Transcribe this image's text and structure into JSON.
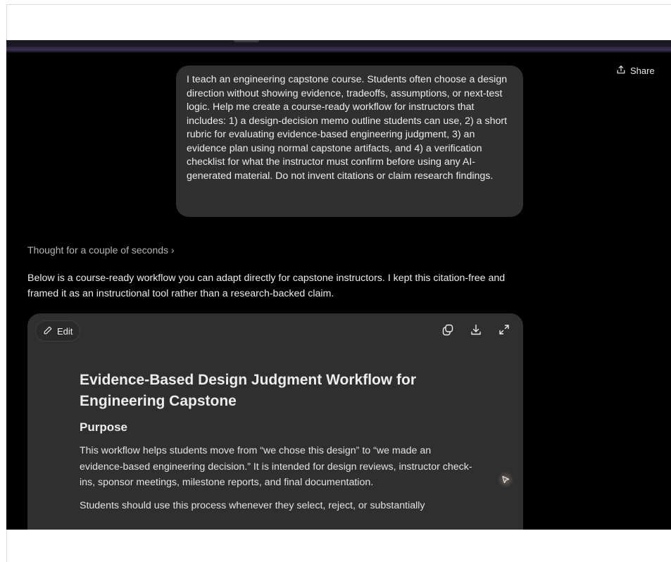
{
  "header": {
    "share_label": "Share",
    "share_icon": "upload-share-icon"
  },
  "conversation": {
    "user_message": "I teach an engineering capstone course. Students often choose a design direction without showing evidence, tradeoffs, assumptions, or next-test logic. Help me create a course-ready workflow for instructors that includes: 1) a design-decision memo outline students can use, 2) a short rubric for evaluating evidence-based engineering judgment, 3) an evidence plan using normal capstone artifacts, and 4) a verification checklist for what the instructor must confirm before using any AI-generated material. Do not invent citations or claim research findings.",
    "thought_label": "Thought for a couple of seconds ›",
    "assistant_intro": "Below is a course-ready workflow you can adapt directly for capstone instructors. I kept this citation-free and framed it as an instructional tool rather than a research-backed claim."
  },
  "canvas": {
    "edit_label": "Edit",
    "tools": [
      "copy-icon",
      "download-icon",
      "expand-icon"
    ],
    "title": "Evidence-Based Design Judgment Workflow for Engineering Capstone",
    "section_heading": "Purpose",
    "paragraph_1": "This workflow helps students move from “we chose this design” to “we made an evidence-based engineering decision.” It is intended for design reviews, instructor check-ins, sponsor meetings, milestone reports, and final documentation.",
    "paragraph_2": "Students should use this process whenever they select, reject, or substantially"
  },
  "colors": {
    "app_background": "#000000",
    "bubble_background": "#303030",
    "canvas_background": "#2f2f2f",
    "text_primary": "#ececec",
    "text_muted": "#b4b4b4"
  }
}
